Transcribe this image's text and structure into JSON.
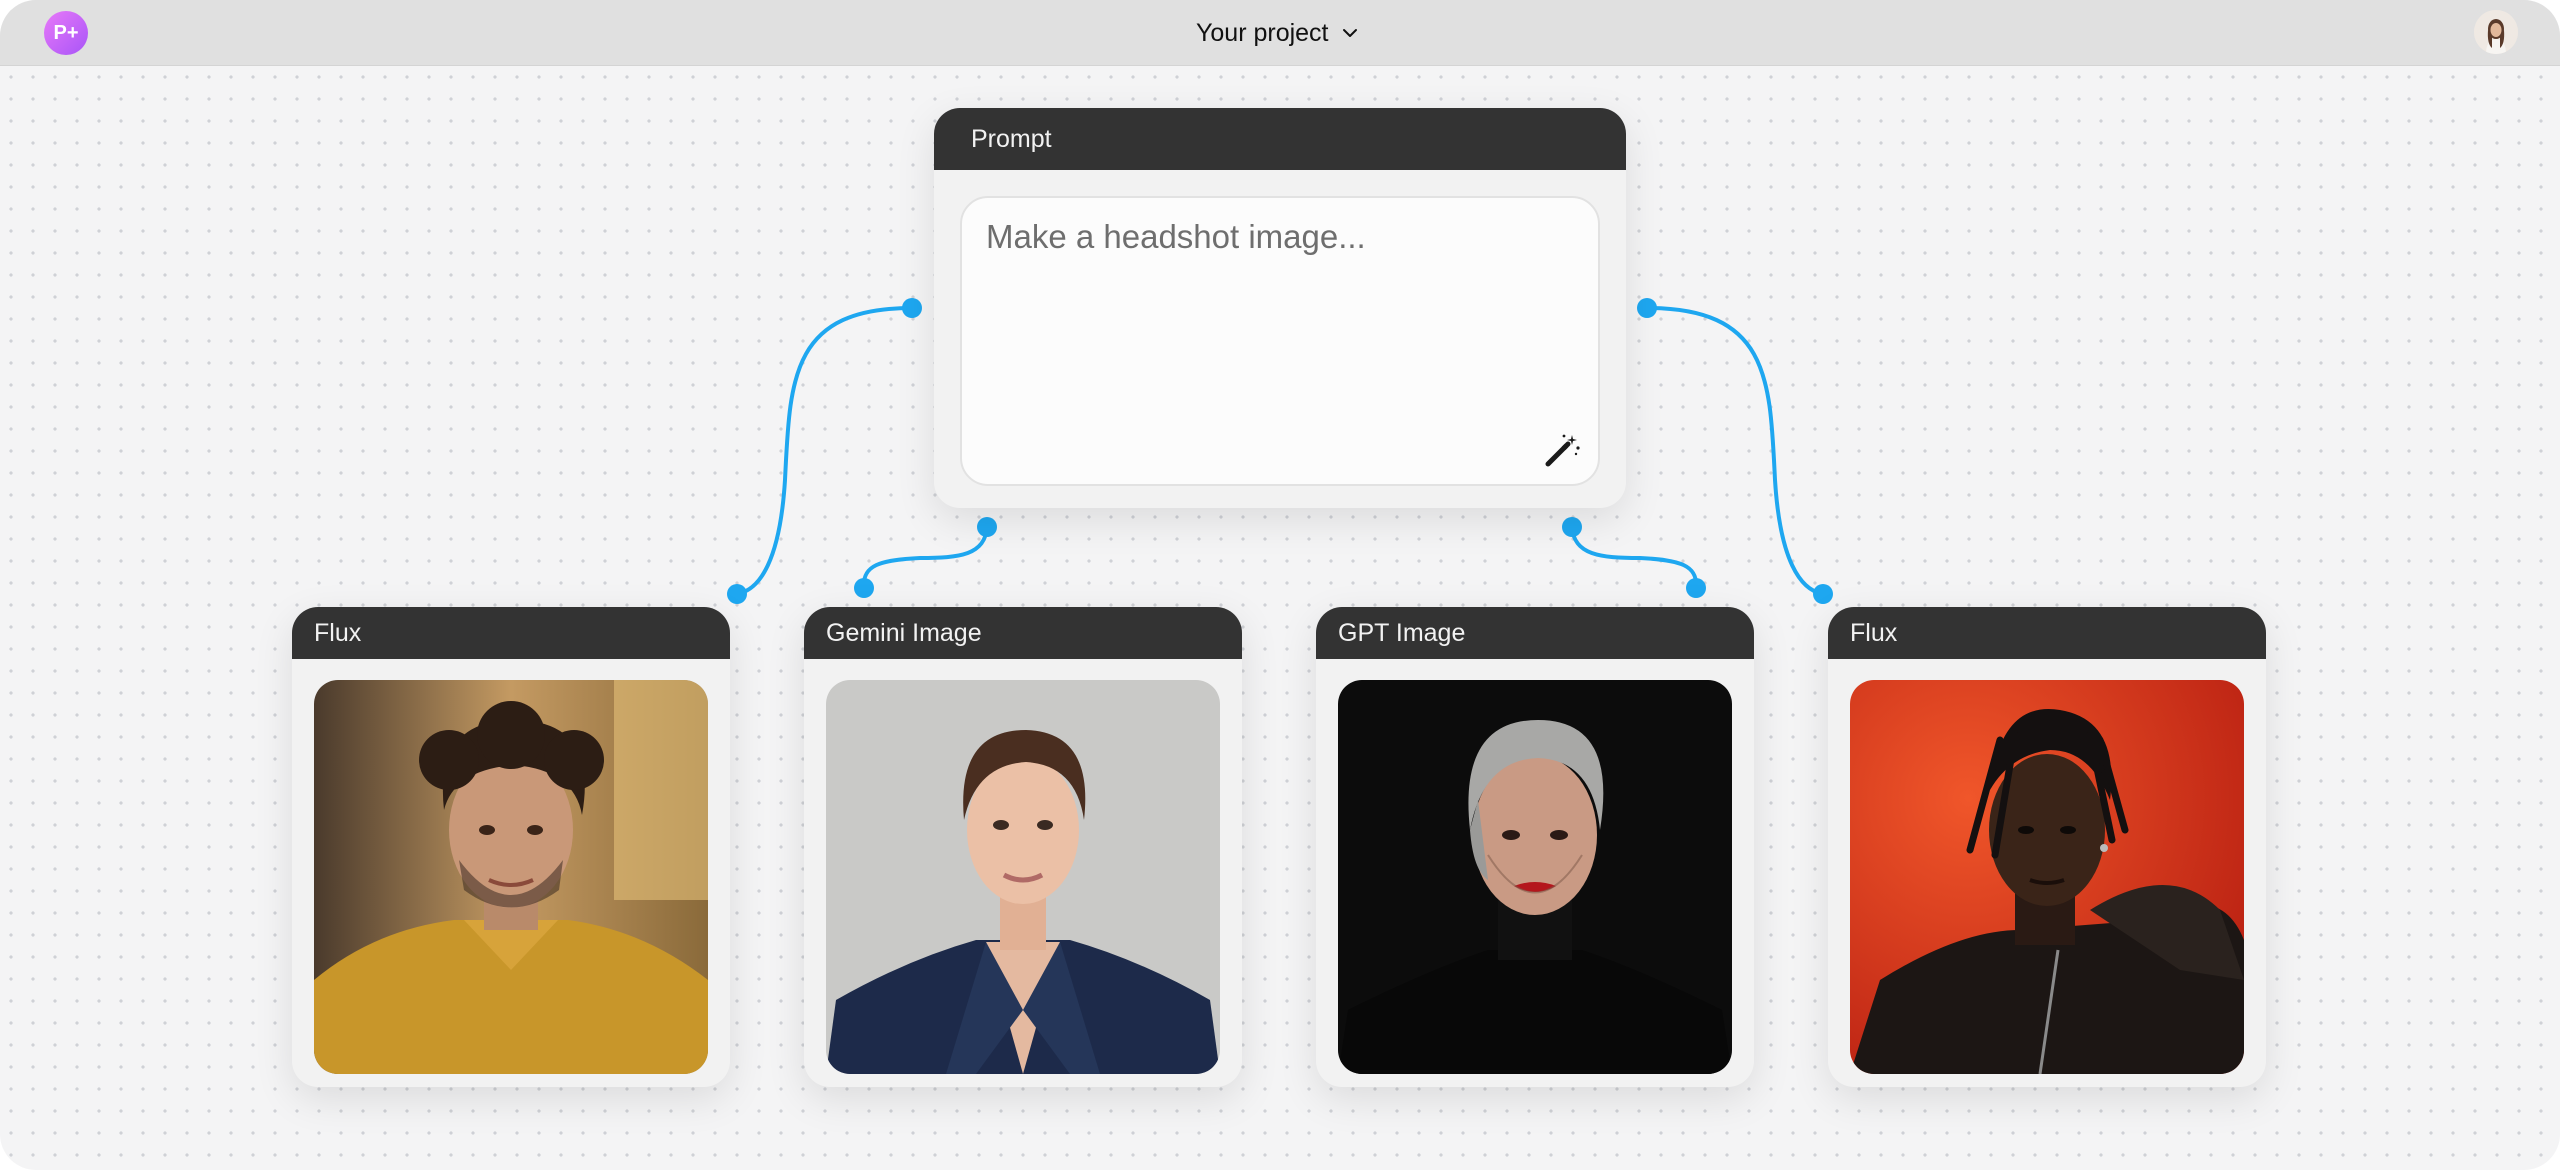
{
  "app": {
    "logo_text": "P+",
    "project_title": "Your project",
    "brand_color": "#c05cf5"
  },
  "prompt_node": {
    "title": "Prompt",
    "placeholder": "Make a headshot image...",
    "enhance_icon": "magic-wand-icon"
  },
  "image_nodes": [
    {
      "title": "Flux",
      "subject": "young man with curly hair in mustard sweater"
    },
    {
      "title": "Gemini Image",
      "subject": "woman in navy blazer on grey background"
    },
    {
      "title": "GPT Image",
      "subject": "older woman with grey hair in black turtleneck"
    },
    {
      "title": "Flux",
      "subject": "man with dreadlocks in dark hoodie on red background"
    }
  ],
  "connector_color": "#1ea7f0"
}
